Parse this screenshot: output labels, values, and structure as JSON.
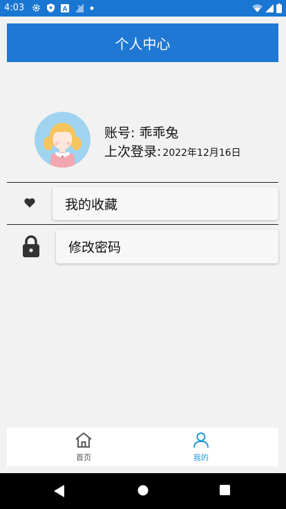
{
  "status_bar": {
    "time": "4:03",
    "icons": [
      "gear-icon",
      "shield-icon",
      "a-icon",
      "signal-question-icon",
      "dot-icon",
      "wifi-icon",
      "cell-signal-icon",
      "battery-icon"
    ]
  },
  "header": {
    "title": "个人中心"
  },
  "profile": {
    "account_label": "账号:",
    "account_value": "乖乖兔",
    "last_login_label": "上次登录:",
    "last_login_value": "2022年12月16日"
  },
  "menu": {
    "favorites_label": "我的收藏",
    "change_password_label": "修改密码"
  },
  "bottom_nav": {
    "home_label": "首页",
    "mine_label": "我的",
    "active": "我的"
  },
  "colors": {
    "primary": "#1e78d4",
    "status_bar": "#1976d2",
    "nav_active": "#1e9bd7"
  }
}
